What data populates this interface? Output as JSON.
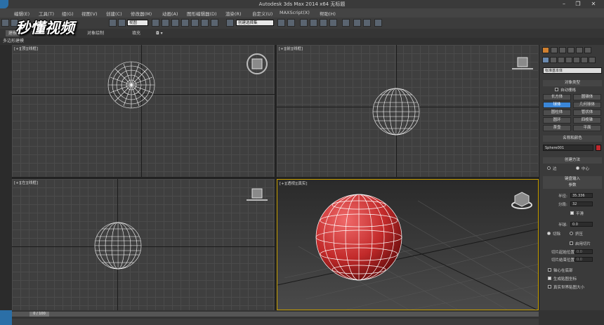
{
  "window": {
    "title": "Autodesk 3ds Max  2014 x64     无标题"
  },
  "menu": [
    "编辑(E)",
    "工具(T)",
    "组(G)",
    "视图(V)",
    "创建(C)",
    "修改器(M)",
    "动画(A)",
    "图形编辑器(D)",
    "渲染(R)",
    "自定义(U)",
    "MAXScript(X)",
    "帮助(H)"
  ],
  "toolbar": {
    "view_dropdown": "视图",
    "selection_set": "创建选择集"
  },
  "ribbon": {
    "tabs": [
      "建模",
      "自由形式",
      "选择",
      "对象绘制",
      "填充"
    ],
    "sub": "多边形建模"
  },
  "watermark": "秒懂视频",
  "viewports": {
    "top": "[+][顶][线框]",
    "front": "[+][前][线框]",
    "left": "[+][左][线框]",
    "persp": "[+][透视][真实]"
  },
  "command_panel": {
    "category_dropdown": "标准基本体",
    "object_type": {
      "header": "对象类型",
      "autogrid": "自动栅格",
      "buttons": [
        "长方体",
        "圆锥体",
        "球体",
        "几何球体",
        "圆柱体",
        "管状体",
        "圆环",
        "四棱锥",
        "茶壶",
        "平面"
      ],
      "selected": "球体"
    },
    "name_color": {
      "header": "名称和颜色",
      "name": "Sphere001",
      "color": "#c0282d"
    },
    "creation_method": {
      "header": "创建方法",
      "edge": "边",
      "center": "中心"
    },
    "keyboard_entry": "键盘输入",
    "parameters": {
      "header": "参数",
      "radius_label": "半径:",
      "radius": "35.336",
      "segments_label": "分段:",
      "segments": "32",
      "smooth": "平滑",
      "hemisphere_label": "半球:",
      "hemisphere": "0.0",
      "chop": "切除",
      "squash": "挤压",
      "slice_on": "启用切片",
      "slice_from_label": "切片起始位置:",
      "slice_from": "0.0",
      "slice_to_label": "切片结束位置:",
      "slice_to": "0.0",
      "base_to_pivot": "轴心在底部",
      "gen_map": "生成贴图坐标",
      "real_world": "真实世界贴图大小"
    }
  },
  "timeline": {
    "frame": "0 / 100"
  }
}
